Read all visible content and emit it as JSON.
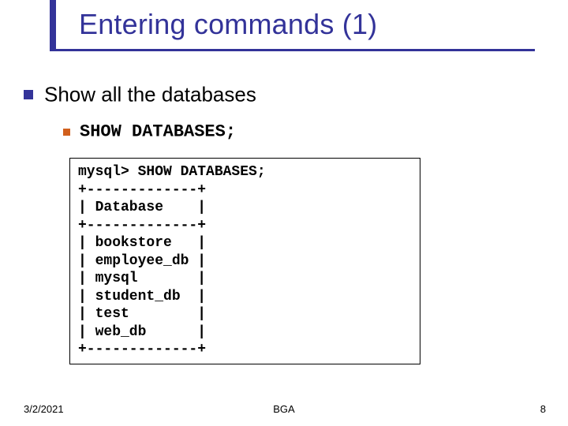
{
  "slide": {
    "title": "Entering commands (1)",
    "bullet1": "Show all the databases",
    "bullet2": "SHOW DATABASES;",
    "code": "mysql> SHOW DATABASES;\n+-------------+\n| Database    |\n+-------------+\n| bookstore   |\n| employee_db |\n| mysql       |\n| student_db  |\n| test        |\n| web_db      |\n+-------------+"
  },
  "footer": {
    "date": "3/2/2021",
    "center": "BGA",
    "page": "8"
  }
}
